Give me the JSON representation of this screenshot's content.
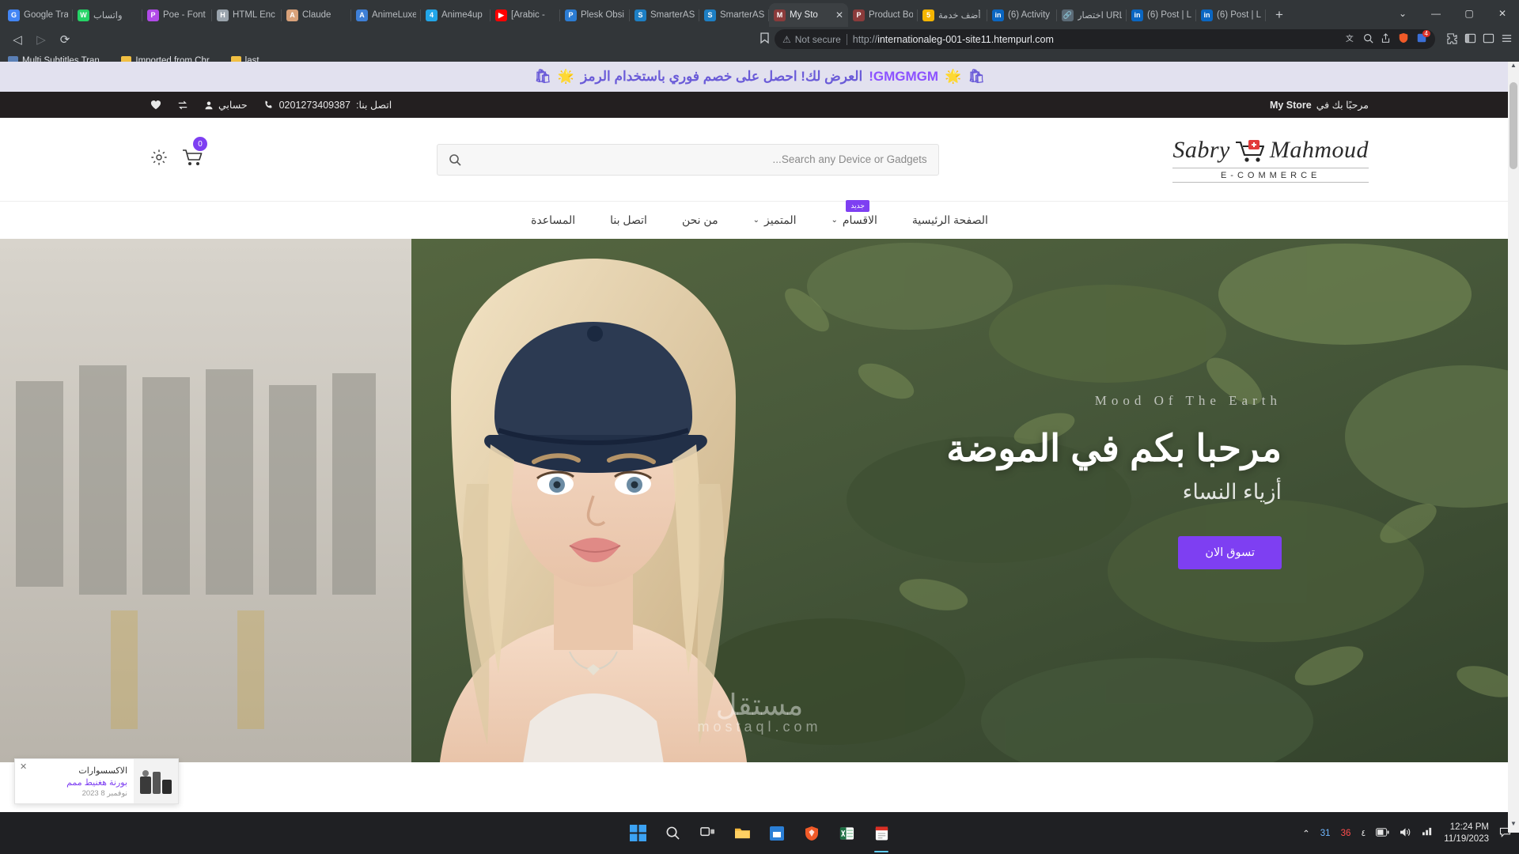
{
  "browser": {
    "tabs": [
      {
        "label": "Google Tra",
        "favicon": "G",
        "color": "#4285f4"
      },
      {
        "label": "واتساب",
        "favicon": "W",
        "color": "#25d366"
      },
      {
        "label": "Poe - Font",
        "favicon": "P",
        "color": "#b14ae8"
      },
      {
        "label": "HTML Enc",
        "favicon": "H",
        "color": "#9aa4ad"
      },
      {
        "label": "Claude",
        "favicon": "A",
        "color": "#d9a27a"
      },
      {
        "label": "AnimeLuxe",
        "favicon": "A",
        "color": "#3e7fd6"
      },
      {
        "label": "Anime4up",
        "favicon": "4",
        "color": "#22a6e8"
      },
      {
        "label": "[Arabic - ",
        "favicon": "▶",
        "color": "#ff0000"
      },
      {
        "label": "Plesk Obsi",
        "favicon": "P",
        "color": "#2b7cd3"
      },
      {
        "label": "SmarterAS",
        "favicon": "S",
        "color": "#1d7fc4"
      },
      {
        "label": "SmarterAS",
        "favicon": "S",
        "color": "#1d7fc4"
      },
      {
        "label": "My Sto",
        "favicon": "M",
        "color": "#8a3b3b",
        "active": true,
        "close": "✕"
      },
      {
        "label": "Product Bo",
        "favicon": "P",
        "color": "#8a3b3b"
      },
      {
        "label": "أضف خدمة",
        "favicon": "5",
        "color": "#f5b500"
      },
      {
        "label": "(6) Activity",
        "favicon": "in",
        "color": "#0a66c2"
      },
      {
        "label": "اختصار URL",
        "favicon": "🔗",
        "color": "#5c6b77"
      },
      {
        "label": "(6) Post | L",
        "favicon": "in",
        "color": "#0a66c2"
      },
      {
        "label": "(6) Post | L",
        "favicon": "in",
        "color": "#0a66c2"
      }
    ],
    "newtab_label": "+",
    "window_controls": {
      "minimize": "—",
      "maximize": "▢",
      "close": "✕",
      "caret": "⌄"
    },
    "nav": {
      "back": "◁",
      "forward": "▷",
      "reload": "⟳",
      "bookmark_star": "⌷"
    },
    "omnibox": {
      "warning_icon": "⚠",
      "security_label": "Not secure",
      "url_scheme": "http://",
      "url_host": "internationaleg-001-site11.htempurl.com",
      "icons": [
        "⇄",
        "🔍",
        "↥",
        "🦁"
      ],
      "badge": "4"
    },
    "right_icons": [
      "🧩",
      "▥",
      "▣",
      "☰"
    ],
    "bookmarks": [
      {
        "label": "Multi Subtitles Tran...",
        "type": "page"
      },
      {
        "label": "Imported from Chr...",
        "type": "folder"
      },
      {
        "label": "last",
        "type": "folder"
      }
    ]
  },
  "site": {
    "promo": {
      "icon_left": "🛍",
      "icon_sun": "🌟",
      "text": "العرض لك! احصل على خصم فوري باستخدام الرمز",
      "code": "GMGMGM!",
      "icon_sun2": "🌟",
      "icon_right": "🛍"
    },
    "topbar": {
      "welcome_prefix": "مرحبًا بك في",
      "store_name": "My Store",
      "contact_label": "اتصل بنا:",
      "phone": "0201273409387",
      "phone_icon": "📞",
      "account_label": "حسابي",
      "account_icon": "user-icon",
      "compare_icon": "⇄",
      "wishlist_icon": "♥"
    },
    "header": {
      "logo_first": "Mahmoud",
      "logo_second": "Sabry",
      "logo_sub": "E-COMMERCE",
      "search_placeholder": "Search any Device or Gadgets...",
      "search_value": "",
      "search_icon": "🔍",
      "cart_count": "0",
      "settings_icon": "⚙"
    },
    "nav": {
      "items": [
        {
          "label": "الصفحة الرئيسية",
          "caret": false,
          "badge": ""
        },
        {
          "label": "الاقسام",
          "caret": true,
          "badge": "جديد"
        },
        {
          "label": "المتميز",
          "caret": true,
          "badge": ""
        },
        {
          "label": "من نحن",
          "caret": false,
          "badge": ""
        },
        {
          "label": "اتصل بنا",
          "caret": false,
          "badge": ""
        },
        {
          "label": "المساعدة",
          "caret": false,
          "badge": ""
        }
      ]
    },
    "hero": {
      "kicker": "Mood Of The Earth",
      "title": "مرحبا بكم في الموضة",
      "subtitle": "أزياء النساء",
      "cta": "تسوق الان",
      "watermark": "مستقل",
      "watermark_sub": "mostaql.com"
    },
    "popup": {
      "close": "✕",
      "line1": "الاكسسوارات",
      "line2": "بورنة هغنيط ممم",
      "line3": "نوفمبر 8 2023"
    }
  },
  "taskbar": {
    "icons": [
      "start-windows",
      "search",
      "task-view",
      "file-explorer",
      "store",
      "brave",
      "excel",
      "pdf"
    ],
    "tray": {
      "chevron": "⌃",
      "items": [
        "31",
        "36",
        "٤"
      ],
      "battery": "▭",
      "volume": "🔊",
      "network": "▰",
      "time": "12:24 PM",
      "date": "11/19/2023",
      "notif": "🗨"
    }
  }
}
